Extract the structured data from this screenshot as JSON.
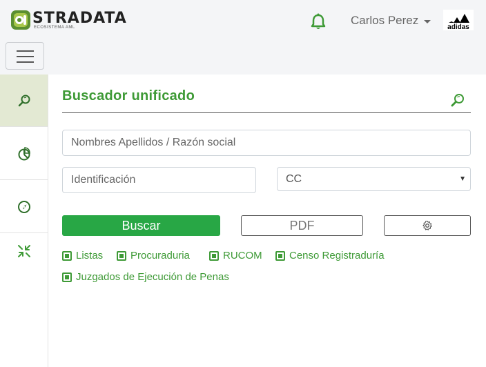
{
  "header": {
    "logo_text": "STRADATA",
    "logo_subtitle": "ECOSISTEMA AML",
    "user_name": "Carlos Perez",
    "brand_name": "adidas",
    "icons": [
      "bell-icon",
      "user-menu-caret-icon",
      "hamburger-menu-icon"
    ]
  },
  "sidebar": {
    "items": [
      {
        "icon": "search-icon",
        "active": true
      },
      {
        "icon": "pie-chart-icon",
        "active": false
      },
      {
        "icon": "compass-icon",
        "active": false
      },
      {
        "icon": "collapse-arrows-icon",
        "active": false
      }
    ]
  },
  "main": {
    "title": "Buscador unificado",
    "name_placeholder": "Nombres Apellidos / Razón social",
    "id_placeholder": "Identificación",
    "doc_type_selected": "CC",
    "buttons": {
      "search": "Buscar",
      "pdf": "PDF",
      "settings_icon": "gear-icon"
    },
    "sources": [
      "Listas",
      "Procuraduria",
      "RUCOM",
      "Censo Registraduría",
      "Juzgados de Ejecución de Penas"
    ]
  },
  "colors": {
    "accent_green": "#3e9a36",
    "button_green": "#28a745",
    "active_sidebar": "#e3e9d3",
    "header_bg": "#f4f5f7"
  }
}
